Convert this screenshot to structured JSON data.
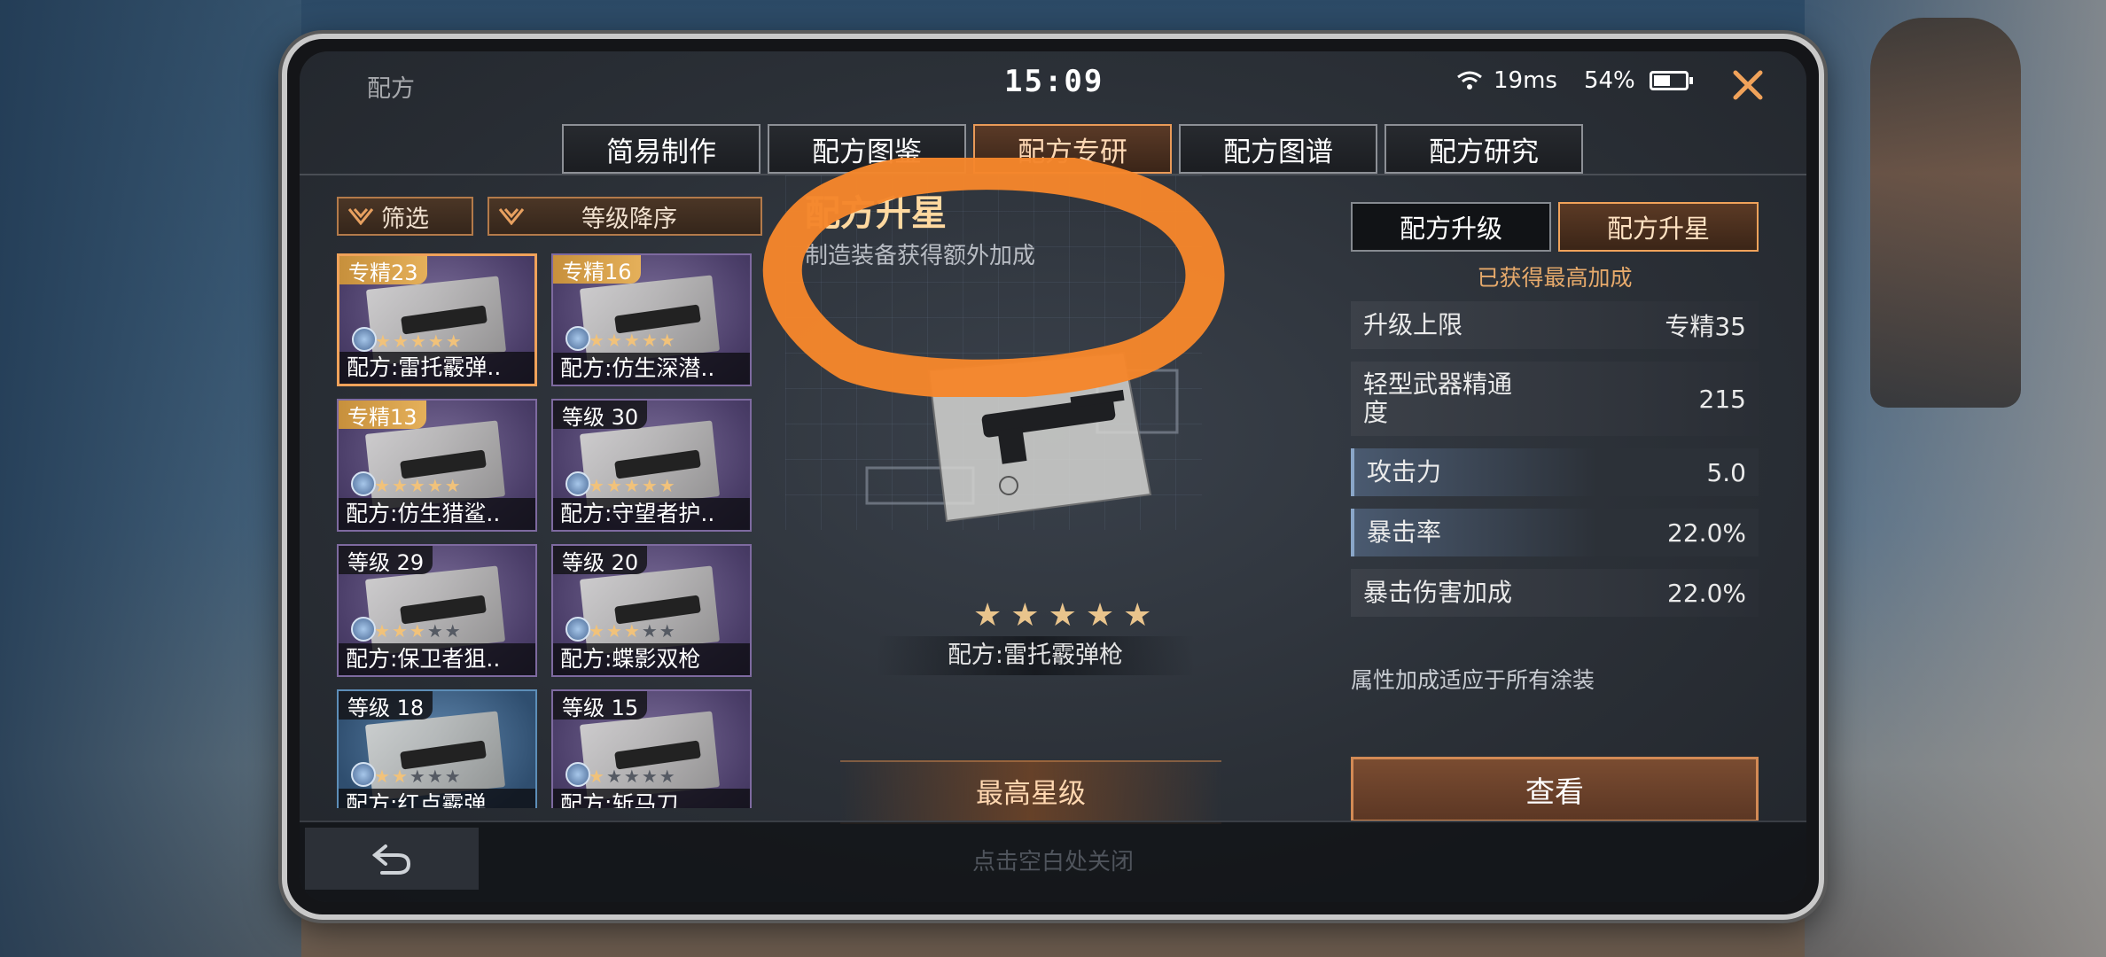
{
  "status": {
    "window_title": "配方",
    "time": "15:09",
    "ping": "19ms",
    "battery": "54%",
    "battery_level": 0.54
  },
  "tabs": [
    {
      "label": "简易制作",
      "active": false
    },
    {
      "label": "配方图鉴",
      "active": false
    },
    {
      "label": "配方专研",
      "active": true
    },
    {
      "label": "配方图谱",
      "active": false
    },
    {
      "label": "配方研究",
      "active": false
    }
  ],
  "filters": {
    "filter_label": "筛选",
    "sort_label": "等级降序"
  },
  "recipes": [
    {
      "badge": "专精23",
      "name": "配方:雷托霰弹..",
      "stars": 5,
      "selected": true,
      "style": "purple"
    },
    {
      "badge": "专精16",
      "name": "配方:仿生深潜..",
      "stars": 5,
      "selected": false,
      "style": "purple"
    },
    {
      "badge": "专精13",
      "name": "配方:仿生猎鲨..",
      "stars": 5,
      "selected": false,
      "style": "purple"
    },
    {
      "badge": "等级 30",
      "name": "配方:守望者护..",
      "stars": 5,
      "selected": false,
      "style": "purple"
    },
    {
      "badge": "等级 29",
      "name": "配方:保卫者狙..",
      "stars": 3,
      "selected": false,
      "style": "purple"
    },
    {
      "badge": "等级 20",
      "name": "配方:蝶影双枪",
      "stars": 3,
      "selected": false,
      "style": "purple"
    },
    {
      "badge": "等级 18",
      "name": "配方:红点霰弹",
      "stars": 2,
      "selected": false,
      "style": "blue"
    },
    {
      "badge": "等级 15",
      "name": "配方:斩马刀",
      "stars": 1,
      "selected": false,
      "style": "purple"
    }
  ],
  "detail": {
    "title": "配方升星",
    "subtitle": "制造装备获得额外加成",
    "item_name": "配方:雷托霰弹枪",
    "stars": 5,
    "max_star_label": "最高星级"
  },
  "right_panel": {
    "subtabs": [
      {
        "label": "配方升级",
        "active": false
      },
      {
        "label": "配方升星",
        "active": true
      }
    ],
    "max_bonus_text": "已获得最高加成",
    "stats": [
      {
        "name": "升级上限",
        "value": "专精35",
        "accent": false
      },
      {
        "name": "轻型武器精通度",
        "value": "215",
        "accent": false
      },
      {
        "name": "攻击力",
        "value": "5.0",
        "accent": true
      },
      {
        "name": "暴击率",
        "value": "22.0%",
        "accent": true
      },
      {
        "name": "暴击伤害加成",
        "value": "22.0%",
        "accent": false
      }
    ],
    "note": "属性加成适应于所有涂装",
    "view_button": "查看"
  },
  "bottom": {
    "hint": "点击空白处关闭"
  },
  "colors": {
    "accent_orange": "#f0a25a",
    "annotation_orange": "#f5862b",
    "gold": "#e5b05a"
  }
}
